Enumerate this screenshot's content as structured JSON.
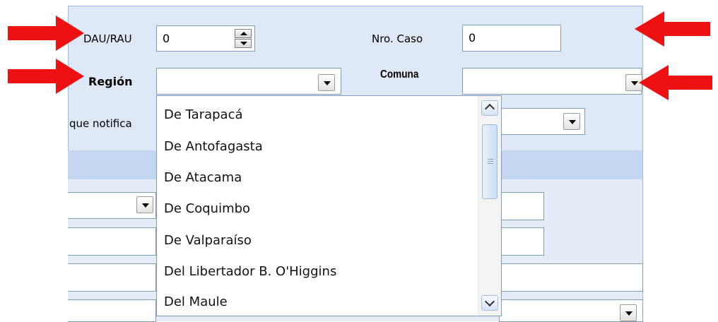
{
  "form": {
    "dau_label": "DAU/RAU",
    "dau_value": "0",
    "caso_label": "Nro. Caso",
    "caso_value": "0",
    "region_label": "Región",
    "region_value": "",
    "comuna_label": "Comuna",
    "comuna_value": "",
    "notifica_label": "que notifica"
  },
  "region_list": {
    "items": [
      "De Tarapacá",
      "De Antofagasta",
      "De Atacama",
      "De Coquimbo",
      "De Valparaíso",
      "Del Libertador B. O'Higgins",
      "Del Maule"
    ]
  },
  "colors": {
    "arrow": "#ee1111",
    "panel": "#dfe8f6",
    "band": "#c3d7f2"
  },
  "icons": {
    "arrows": "red-arrow-icon",
    "spinner": "spinner-icon",
    "dropdown": "dropdown-arrow-icon"
  }
}
